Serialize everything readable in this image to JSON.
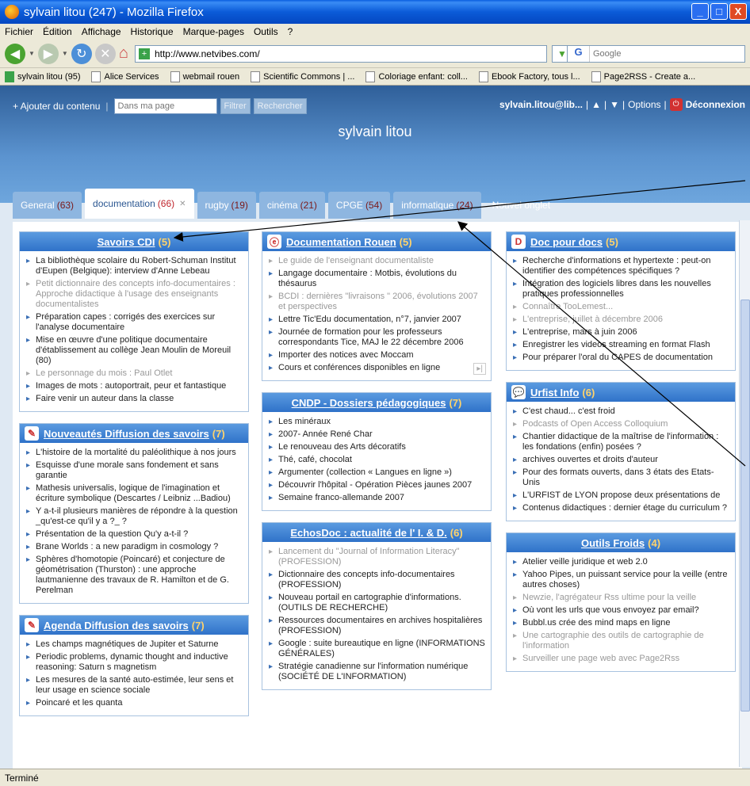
{
  "window": {
    "title": "sylvain litou (247) - Mozilla Firefox"
  },
  "menu": [
    "Fichier",
    "Édition",
    "Affichage",
    "Historique",
    "Marque-pages",
    "Outils",
    "?"
  ],
  "nav": {
    "url": "http://www.netvibes.com/",
    "search_placeholder": "Google"
  },
  "bookmarks": [
    {
      "label": "sylvain litou (95)",
      "icon": "netvibes-icon"
    },
    {
      "label": "Alice Services",
      "icon": "page-icon"
    },
    {
      "label": "webmail rouen",
      "icon": "page-icon"
    },
    {
      "label": "Scientific Commons | ...",
      "icon": "sc-icon"
    },
    {
      "label": "Coloriage enfant: coll...",
      "icon": "star-icon"
    },
    {
      "label": "Ebook Factory, tous l...",
      "icon": "page-icon"
    },
    {
      "label": "Page2RSS - Create a...",
      "icon": "page-icon"
    }
  ],
  "netvibes": {
    "add_content": "+ Ajouter du contenu",
    "search_placeholder": "Dans ma page",
    "filter": "Filtrer",
    "search": "Rechercher",
    "user": "sylvain.litou@lib...",
    "options": "Options",
    "logout": "Déconnexion",
    "page_title": "sylvain litou",
    "tabs": [
      {
        "label": "General",
        "count": "(63)"
      },
      {
        "label": "documentation",
        "count": "(66)"
      },
      {
        "label": "rugby",
        "count": "(19)"
      },
      {
        "label": "cinéma",
        "count": "(21)"
      },
      {
        "label": "CPGE",
        "count": "(54)"
      },
      {
        "label": "informatique",
        "count": "(24)"
      }
    ],
    "new_tab": "Nouvel onglet"
  },
  "widgets": {
    "savoirs": {
      "title": "Savoirs CDI",
      "count": "(5)",
      "items": [
        "La bibliothèque scolaire du Robert-Schuman Institut d'Eupen (Belgique): interview d'Anne Lebeau",
        "Petit dictionnaire des concepts info-documentaires : Approche didactique à l'usage des enseignants documentalistes",
        "Préparation capes : corrigés des exercices sur l'analyse documentaire",
        "Mise en œuvre d'une politique documentaire d'établissement au collège Jean Moulin de Moreuil (80)",
        "Le personnage du mois : Paul Otlet",
        "Images de mots : autoportrait, peur et fantastique",
        "Faire venir un auteur dans la classe"
      ]
    },
    "nouveautes": {
      "title": "Nouveautés Diffusion des savoirs",
      "count": "(7)",
      "items": [
        "L'histoire de la mortalité du paléolithique à nos jours",
        "Esquisse d'une morale sans fondement et sans garantie",
        "Mathesis universalis, logique de l'imagination et écriture symbolique (Descartes / Leibniz ...Badiou)",
        "Y a-t-il plusieurs manières de répondre à la question _qu'est-ce qu'il y a ?_ ?",
        "Présentation de la question Qu'y a-t-il ?",
        "Brane Worlds : a new paradigm in cosmology ?",
        "Sphères d'homotopie (Poincaré) et conjecture de géométrisation (Thurston) : une approche lautmanienne des travaux de R. Hamilton et de G. Perelman"
      ]
    },
    "agenda": {
      "title": "Agenda Diffusion des savoirs",
      "count": "(7)",
      "items": [
        "Les champs magnétiques de Jupiter et Saturne",
        "Periodic problems, dynamic thought and inductive reasoning: Saturn s magnetism",
        "Les mesures de la santé auto-estimée, leur sens et leur usage en science sociale",
        "Poincaré et les quanta"
      ]
    },
    "docrouen": {
      "title": "Documentation Rouen",
      "count": "(5)",
      "items": [
        "Le guide de l'enseignant documentaliste",
        "Langage documentaire : Motbis, évolutions du thésaurus",
        "BCDI : dernières \"livraisons \" 2006, évolutions 2007 et perspectives",
        "Lettre Tic'Edu documentation, n°7, janvier 2007",
        "Journée de formation pour les professeurs correspondants Tice, MAJ le 22 décembre 2006",
        "Importer des notices avec Moccam",
        "Cours et conférences disponibles en ligne"
      ]
    },
    "cndp": {
      "title": "CNDP - Dossiers pédagogiques",
      "count": "(7)",
      "items": [
        "Les minéraux",
        "2007- Année René Char",
        "Le renouveau des Arts décoratifs",
        "Thé, café, chocolat",
        "Argumenter (collection « Langues en ligne »)",
        "Découvrir l'hôpital - Opération Pièces jaunes 2007",
        "Semaine franco-allemande 2007"
      ]
    },
    "echosdoc": {
      "title": "EchosDoc : actualité de l' I. & D.",
      "count": "(6)",
      "items": [
        "Lancement du \"Journal of Information Literacy\" (PROFESSION)",
        "Dictionnaire des concepts info-documentaires (PROFESSION)",
        "Nouveau portail en cartographie d'informations. (OUTILS DE RECHERCHE)",
        "Ressources documentaires en archives hospitalières (PROFESSION)",
        "Google : suite bureautique en ligne (INFORMATIONS GÉNÉRALES)",
        "Stratégie canadienne sur l'information numérique (SOCIÉTÉ DE L'INFORMATION)"
      ]
    },
    "docpourdocs": {
      "title": "Doc pour docs",
      "count": "(5)",
      "items": [
        "Recherche d'informations et hypertexte : peut-on identifier des compétences spécifiques ?",
        "Intégration des logiciels libres dans les nouvelles pratiques professionnelles",
        "Connaître TooLemest...",
        "L'entreprise, juillet à décembre 2006",
        "L'entreprise, mars à juin 2006",
        "Enregistrer les videos streaming en format Flash",
        "Pour préparer l'oral du CAPES de documentation"
      ]
    },
    "urfist": {
      "title": "Urfist Info",
      "count": "(6)",
      "items": [
        "C'est chaud... c'est froid",
        "Podcasts of Open Access Colloquium",
        "Chantier didactique de la maîtrise de l'information : les fondations (enfin) posées ?",
        "archives ouvertes et droits d'auteur",
        "Pour des formats ouverts, dans 3 états des Etats-Unis",
        "L'URFIST de LYON propose deux présentations de",
        "Contenus didactiques : dernier étage du curriculum ?"
      ]
    },
    "outils": {
      "title": "Outils Froids",
      "count": "(4)",
      "items": [
        "Atelier veille juridique et web 2.0",
        "Yahoo Pipes, un puissant service pour la veille (entre autres choses)",
        "Newzie, l'agrégateur Rss ultime pour la veille",
        "Où vont les urls que vous envoyez par email?",
        "Bubbl.us crée des mind maps en ligne",
        "Une cartographie des outils de cartographie de l'information",
        "Surveiller une page web avec Page2Rss"
      ]
    }
  },
  "status": "Terminé"
}
